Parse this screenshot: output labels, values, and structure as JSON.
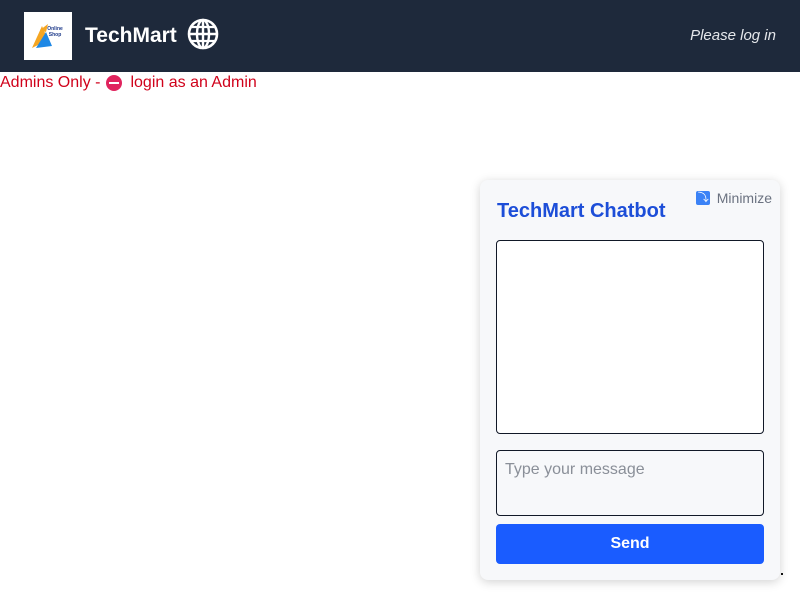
{
  "header": {
    "logo_text": "Online Shop",
    "brand": "TechMart",
    "globe_icon": "globe-icon",
    "login_status": "Please log in"
  },
  "admin_notice": {
    "prefix": "Admins Only -",
    "icon": "no-entry-icon",
    "link_text": "login as an Admin"
  },
  "chatbot": {
    "title": "TechMart Chatbot",
    "minimize_label": "Minimize",
    "minimize_icon": "minimize-icon",
    "message_placeholder": "Type your message",
    "message_value": "",
    "send_label": "Send"
  },
  "colors": {
    "header_bg": "#1e293b",
    "notice_red": "#d0021b",
    "chat_title_blue": "#1d4ed8",
    "send_blue": "#1a5cff"
  }
}
